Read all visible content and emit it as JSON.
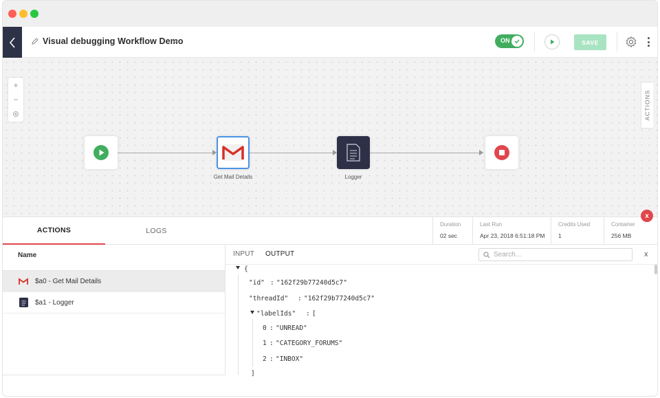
{
  "header": {
    "title": "Visual debugging Workflow Demo",
    "toggle_label": "ON",
    "save_label": "SAVE"
  },
  "canvas": {
    "side_tab": "ACTIONS",
    "nodes": [
      {
        "label": ""
      },
      {
        "label": "Get Mail Details"
      },
      {
        "label": "Logger"
      },
      {
        "label": ""
      }
    ]
  },
  "panel": {
    "close_label": "x",
    "tabs": [
      "ACTIONS",
      "LOGS"
    ],
    "stats": [
      {
        "key": "Duration",
        "value": "02 sec"
      },
      {
        "key": "Last Run",
        "value": "Apr 23, 2018 6:51:18 PM"
      },
      {
        "key": "Credits Used",
        "value": "1"
      },
      {
        "key": "Container",
        "value": "256 MB"
      }
    ],
    "list_header": "Name",
    "items": [
      "$a0 - Get Mail Details",
      "$a1 - Logger"
    ],
    "io_tabs": [
      "INPUT",
      "OUTPUT"
    ],
    "search_placeholder": "Search...",
    "close_output": "x",
    "json": {
      "open_brace": "{",
      "id_key": "\"id\"",
      "id_val": "\"162f29b77240d5c7\"",
      "thread_key": "\"threadId\"",
      "thread_val": "\"162f29b77240d5c7\"",
      "labels_key": "\"labelIds\"",
      "open_bracket": "[",
      "labels": [
        {
          "index": "0",
          "value": "\"UNREAD\""
        },
        {
          "index": "1",
          "value": "\"CATEGORY_FORUMS\""
        },
        {
          "index": "2",
          "value": "\"INBOX\""
        }
      ],
      "close_bracket": "]",
      "colon": ":"
    }
  },
  "colors": {
    "accent_red": "#e0474c",
    "toggle_green": "#41ad5f",
    "save_disabled": "#a9e4c2",
    "dark_nav": "#2e3246",
    "selected_node_border": "#4b93e6"
  },
  "icons": {
    "back": "chevron-left-icon",
    "edit": "pencil-icon",
    "dropdown": "chevron-down-icon",
    "toggle_check": "check-icon",
    "run": "play-icon",
    "settings": "gear-icon",
    "more": "kebab-icon",
    "start_node": "play-circle-icon",
    "gmail_node": "gmail-icon",
    "logger_node": "document-icon",
    "stop_node": "stop-circle-icon",
    "search": "search-icon"
  }
}
